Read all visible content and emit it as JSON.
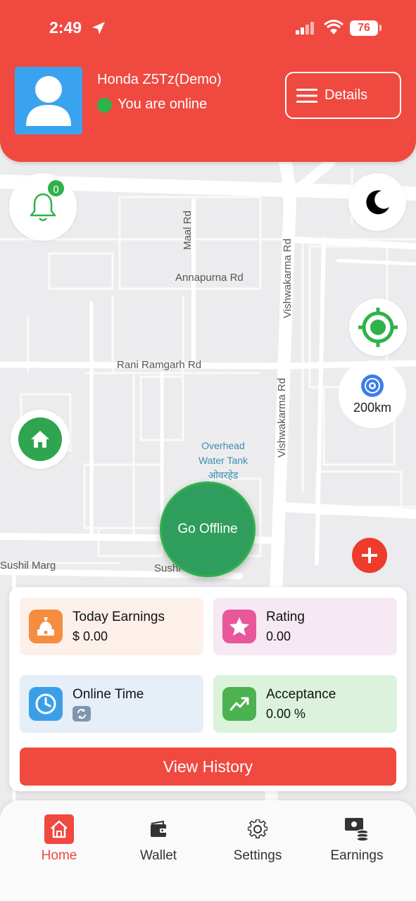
{
  "status_bar": {
    "time": "2:49",
    "battery": "76"
  },
  "header": {
    "driver_name": "Honda Z5Tz(Demo)",
    "online_status": "You are online",
    "details_label": "Details"
  },
  "map": {
    "notification_count": "0",
    "search_radius": "200km",
    "go_offline_label": "Go Offline",
    "street_labels": {
      "maal_rd": "Maal Rd",
      "annapurna_rd": "Annapurna Rd",
      "vishwakarma_rd_top": "Vishwakarma Rd",
      "rani_ramgarh_rd": "Rani Ramgarh Rd",
      "vishwakarma_rd_bottom": "Vishwakarma Rd",
      "sushil_marg": "Sushil Marg",
      "sushil_partial": "Sushi"
    },
    "poi": {
      "line1": "Overhead",
      "line2": "Water Tank",
      "line3": "ओवरहेड"
    }
  },
  "stats": {
    "today_earnings": {
      "title": "Today Earnings",
      "value": "$ 0.00"
    },
    "rating": {
      "title": "Rating",
      "value": "0.00"
    },
    "online_time": {
      "title": "Online Time"
    },
    "acceptance": {
      "title": "Acceptance",
      "value": "0.00 %"
    },
    "view_history_label": "View History"
  },
  "nav": {
    "items": [
      {
        "label": "Home",
        "icon": "home-icon",
        "active": true
      },
      {
        "label": "Wallet",
        "icon": "wallet-icon"
      },
      {
        "label": "Settings",
        "icon": "gear-icon"
      },
      {
        "label": "Earnings",
        "icon": "earnings-icon"
      }
    ]
  },
  "colors": {
    "primary": "#ef4940",
    "online_green": "#2fb24b",
    "go_offline": "#2f9e5c",
    "avatar_blue": "#3aa3ef",
    "earnings_bg": "#fdf0ea",
    "rating_bg": "#f6e9f3",
    "online_time_bg": "#e6eef8",
    "acceptance_bg": "#dbf3dc"
  }
}
